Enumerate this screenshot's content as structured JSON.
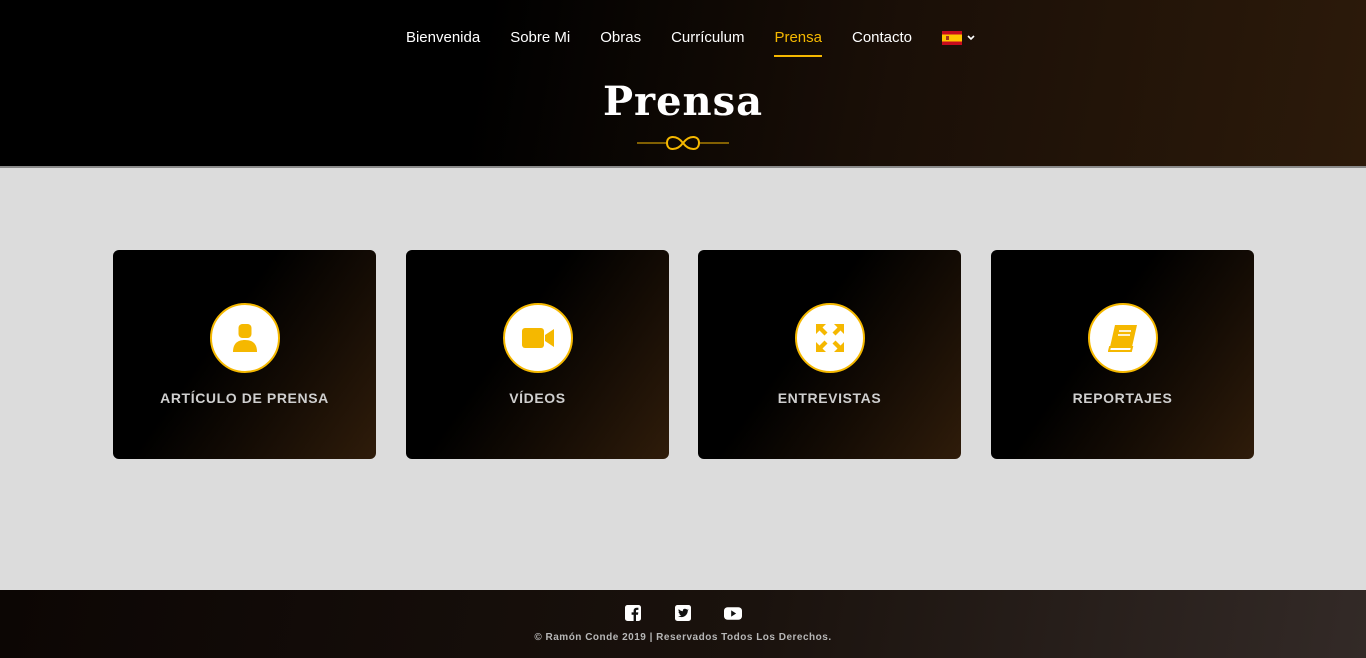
{
  "nav": {
    "items": [
      {
        "label": "Bienvenida"
      },
      {
        "label": "Sobre Mi"
      },
      {
        "label": "Obras"
      },
      {
        "label": "Currículum"
      },
      {
        "label": "Prensa",
        "active": true
      },
      {
        "label": "Contacto"
      }
    ],
    "language_icon": "spain-flag-icon"
  },
  "header": {
    "title": "Prensa",
    "divider_icon": "infinity-ornament-icon"
  },
  "cards": [
    {
      "label": "ARTÍCULO DE PRENSA",
      "icon": "user-icon"
    },
    {
      "label": "VÍDEOS",
      "icon": "video-camera-icon"
    },
    {
      "label": "ENTREVISTAS",
      "icon": "expand-arrows-icon"
    },
    {
      "label": "REPORTAJES",
      "icon": "book-icon"
    }
  ],
  "footer": {
    "social": [
      "facebook-icon",
      "twitter-icon",
      "youtube-icon"
    ],
    "copyright": "© Ramón Conde 2019 | Reservados Todos Los Derechos."
  },
  "colors": {
    "accent": "#f5b800",
    "background": "#dcdcdc",
    "card": "#000000",
    "header": "#000000"
  }
}
